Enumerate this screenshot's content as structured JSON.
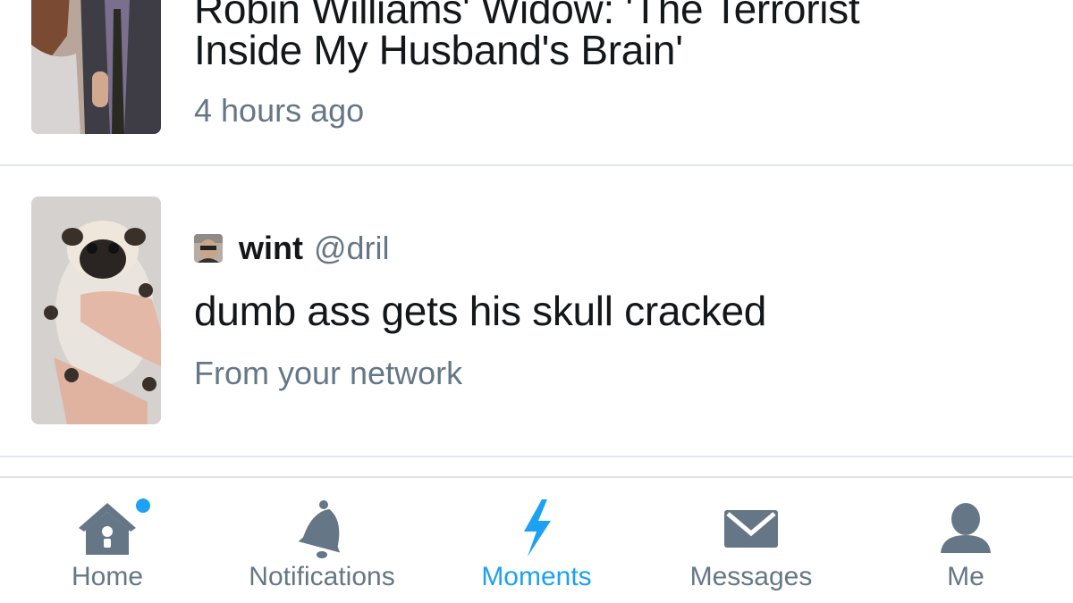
{
  "feed": {
    "story_top": {
      "title_line1": "Robin Williams' Widow: 'The Terrorist",
      "title_line2": "Inside My Husband's Brain'",
      "time": "4 hours ago"
    },
    "story_tweet": {
      "author_name": "wint",
      "author_handle": "@dril",
      "text": "dumb ass gets his skull cracked",
      "context": "From your network"
    }
  },
  "tabbar": {
    "tabs": [
      {
        "label": "Home",
        "icon": "home-icon",
        "has_badge": true
      },
      {
        "label": "Notifications",
        "icon": "bell-icon"
      },
      {
        "label": "Moments",
        "icon": "lightning-icon",
        "active": true
      },
      {
        "label": "Messages",
        "icon": "envelope-icon"
      },
      {
        "label": "Me",
        "icon": "person-icon"
      }
    ]
  },
  "colors": {
    "accent": "#1da1f2",
    "text_primary": "#14171a",
    "text_secondary": "#657786",
    "icon_inactive": "#657786",
    "divider": "#e1e8ed"
  }
}
